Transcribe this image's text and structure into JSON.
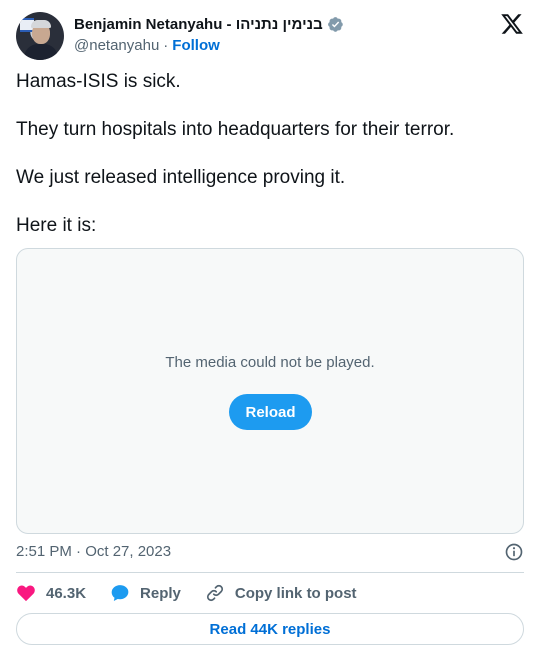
{
  "author": {
    "display_name": "Benjamin Netanyahu - בנימין נתניהו",
    "handle": "@netanyahu",
    "separator": "·",
    "follow_label": "Follow",
    "verified_color": "#829aab"
  },
  "tweet": {
    "paragraphs": [
      "Hamas-ISIS is sick.",
      "They turn hospitals into headquarters for their terror.",
      "We just released intelligence proving it.",
      "Here it is:"
    ],
    "timestamp": "2:51 PM · Oct 27, 2023"
  },
  "media": {
    "message": "The media could not be played.",
    "reload_label": "Reload"
  },
  "actions": {
    "like_count": "46.3K",
    "reply_label": "Reply",
    "copy_link_label": "Copy link to post"
  },
  "read_replies_label": "Read 44K replies",
  "colors": {
    "like": "#f91880",
    "reply": "#1d9bf0",
    "link": "#006fd6"
  },
  "icons": [
    "x-logo-icon",
    "verified-badge-icon",
    "info-icon",
    "heart-icon",
    "reply-bubble-icon",
    "link-icon"
  ]
}
